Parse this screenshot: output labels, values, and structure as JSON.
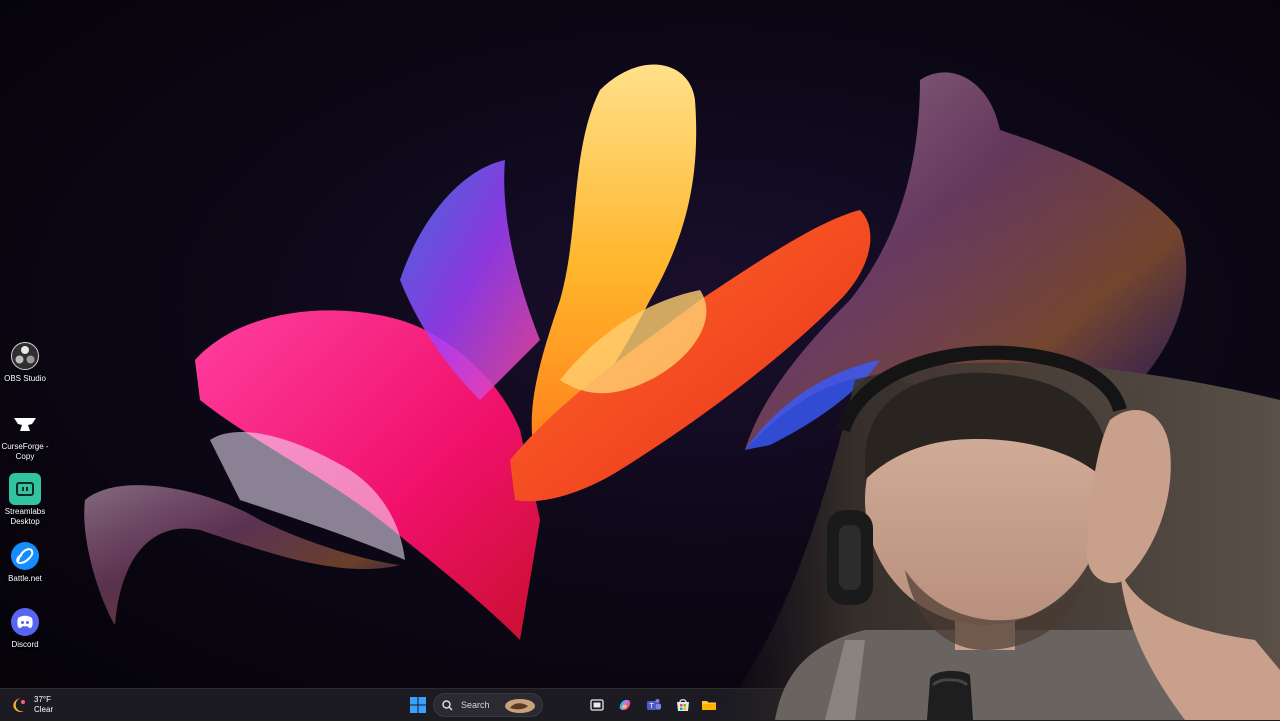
{
  "desktop_icons": [
    {
      "label": "OBS Studio",
      "icon": "obs-icon"
    },
    {
      "label": "CurseForge - Copy",
      "icon": "curseforge-icon"
    },
    {
      "label": "Streamlabs Desktop",
      "icon": "streamlabs-icon"
    },
    {
      "label": "Battle.net",
      "icon": "battlenet-icon"
    },
    {
      "label": "Discord",
      "icon": "discord-icon"
    }
  ],
  "taskbar": {
    "weather": {
      "temp": "37°F",
      "condition": "Clear"
    },
    "search_label": "Search",
    "pinned_icons": [
      "windows-start-icon",
      "search-icon",
      "task-view-icon",
      "copilot-icon",
      "teams-icon",
      "store-icon",
      "file-explorer-icon"
    ]
  },
  "colors": {
    "taskbar_bg": "#1c1b22",
    "windows_blue": "#3aa0ff",
    "discord": "#5865f2",
    "streamlabs": "#31c3a2",
    "battlenet": "#148eff"
  }
}
